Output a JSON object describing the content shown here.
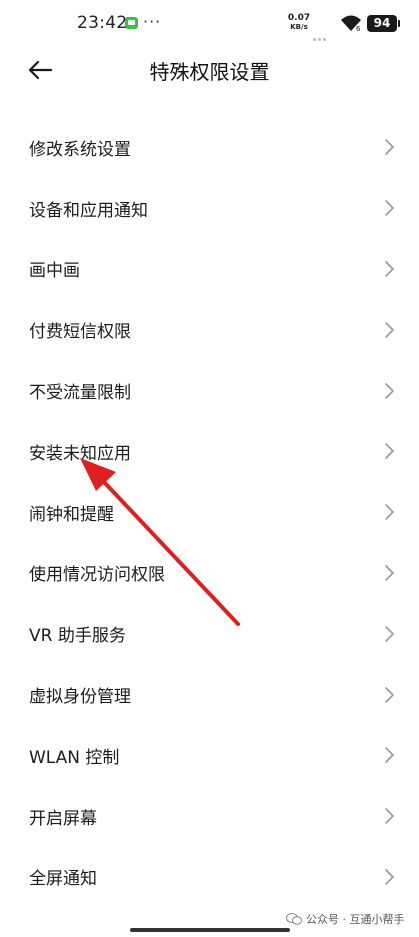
{
  "status_bar": {
    "time": "23:42",
    "dots": "···",
    "net_speed_value": "0.07",
    "net_speed_unit": "KB/s",
    "battery": "94"
  },
  "header": {
    "title": "特殊权限设置"
  },
  "items": [
    {
      "label": "修改系统设置"
    },
    {
      "label": "设备和应用通知"
    },
    {
      "label": "画中画"
    },
    {
      "label": "付费短信权限"
    },
    {
      "label": "不受流量限制"
    },
    {
      "label": "安装未知应用"
    },
    {
      "label": "闹钟和提醒"
    },
    {
      "label": "使用情况访问权限"
    },
    {
      "label": "VR 助手服务"
    },
    {
      "label": "虚拟身份管理"
    },
    {
      "label": "WLAN 控制"
    },
    {
      "label": "开启屏幕"
    },
    {
      "label": "全屏通知"
    }
  ],
  "watermark": {
    "text": "公众号 · 互通小帮手"
  },
  "colors": {
    "annotation_arrow": "#e02020",
    "chevron": "#9a9a9a"
  }
}
